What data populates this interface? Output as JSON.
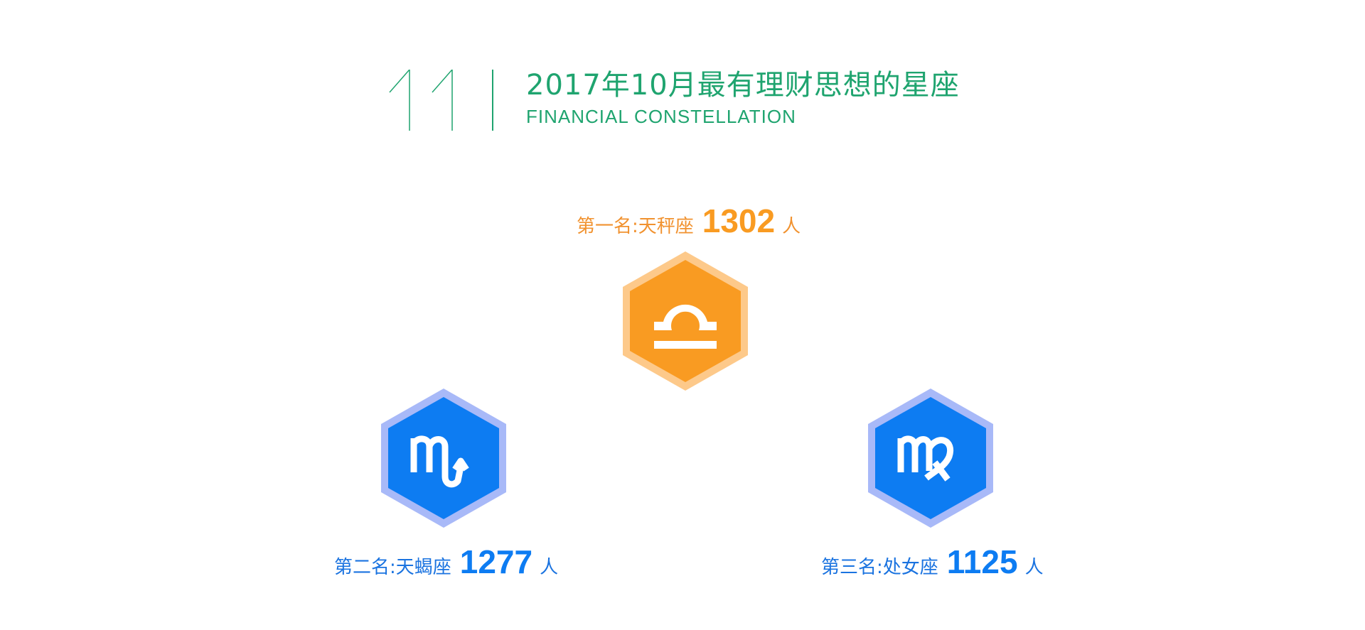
{
  "header": {
    "section_number": "11",
    "title": "2017年10月最有理财思想的星座",
    "subtitle": "FINANCIAL CONSTELLATION"
  },
  "rankings": [
    {
      "label": "第一名:天秤座",
      "count": "1302",
      "unit": "人",
      "icon": "libra-icon",
      "color": "#f99b22",
      "ring_color": "#fdc98a"
    },
    {
      "label": "第二名:天蝎座",
      "count": "1277",
      "unit": "人",
      "icon": "scorpio-icon",
      "color": "#0d7cf2",
      "ring_color": "#a8b9f8"
    },
    {
      "label": "第三名:处女座",
      "count": "1125",
      "unit": "人",
      "icon": "virgo-icon",
      "color": "#0d7cf2",
      "ring_color": "#a8b9f8"
    }
  ],
  "colors": {
    "accent_green": "#1fa46f",
    "orange": "#f99b22",
    "blue": "#0d7cf2",
    "text_orange": "#f1922f",
    "text_blue": "#1a73e0"
  }
}
